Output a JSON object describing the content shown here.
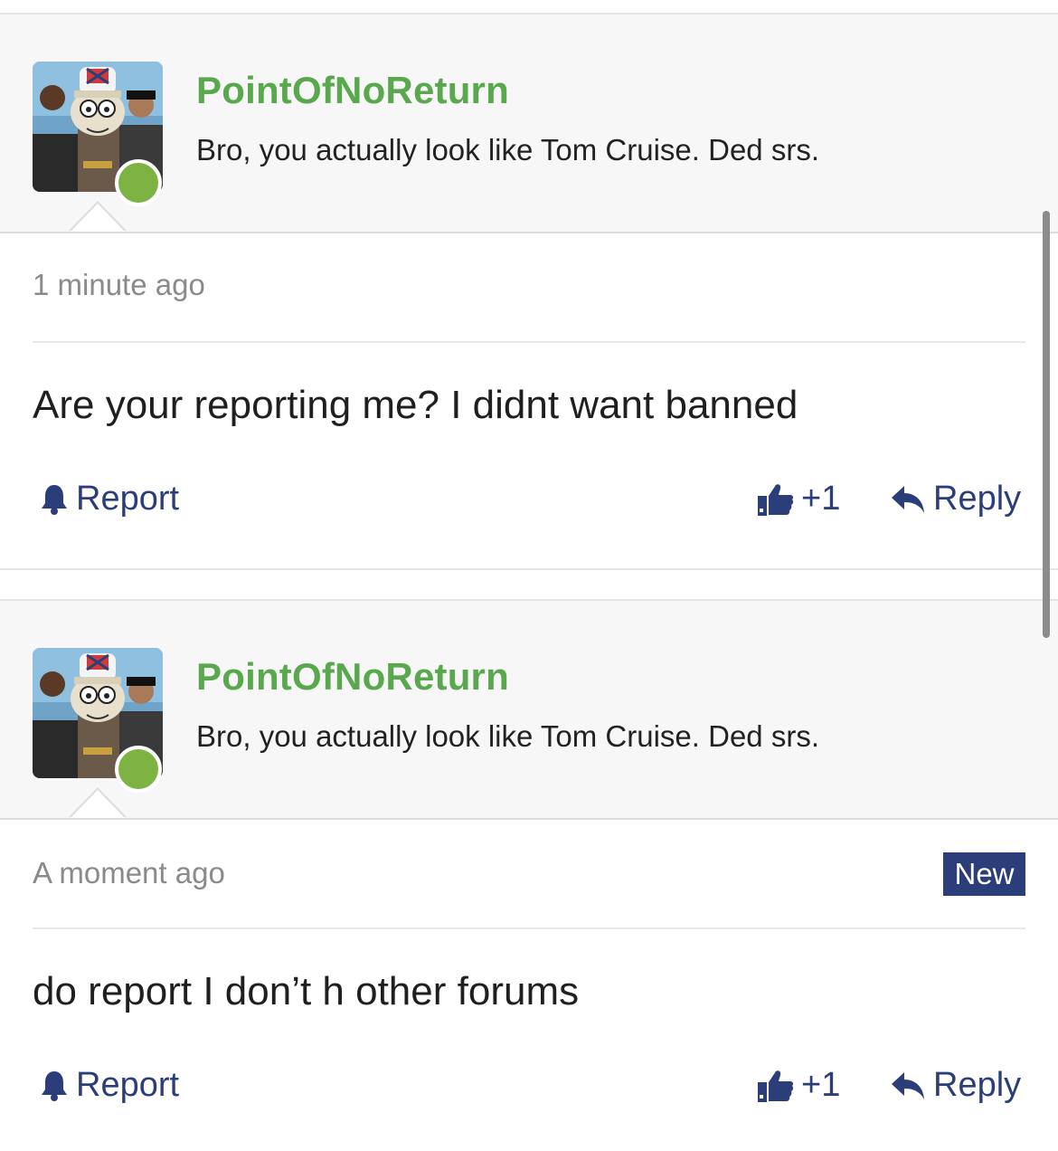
{
  "posts": [
    {
      "quote": {
        "username": "PointOfNoReturn",
        "text": "Bro, you actually look like Tom Cruise. Ded srs."
      },
      "time": "1 minute ago",
      "badge": "",
      "body": "Are your reporting me? I didnt want banned",
      "actions": {
        "report": "Report",
        "like": "+1",
        "reply": "Reply"
      }
    },
    {
      "quote": {
        "username": "PointOfNoReturn",
        "text": "Bro, you actually look like Tom Cruise. Ded srs."
      },
      "time": "A moment ago",
      "badge": "New",
      "body": "do report I don’t h other forums",
      "actions": {
        "report": "Report",
        "like": "+1",
        "reply": "Reply"
      }
    }
  ],
  "colors": {
    "username": "#5aa84e",
    "action": "#2c3e7a",
    "online": "#7cb342",
    "badge_bg": "#2c3e7a"
  },
  "icons": {
    "report": "bell-icon",
    "like": "thumbs-up-icon",
    "reply": "reply-arrow-icon"
  }
}
